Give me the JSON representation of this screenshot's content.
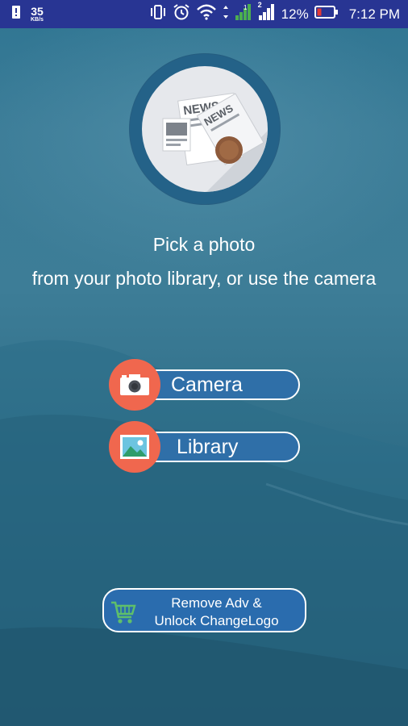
{
  "status_bar": {
    "net_speed_value": "35",
    "net_speed_unit": "KB/s",
    "battery_percent": "12%",
    "time": "7:12 PM",
    "sim_label": "2"
  },
  "prompt": {
    "line1": "Pick a photo",
    "line2": "from your photo library, or use the camera"
  },
  "buttons": {
    "camera_label": "Camera",
    "library_label": "Library"
  },
  "upgrade": {
    "line1": "Remove Adv &",
    "line2": "Unlock ChangeLogo"
  },
  "logo": {
    "news_text_1": "NEWS",
    "news_text_2": "NEWS"
  },
  "colors": {
    "status_bar": "#283593",
    "accent_orange": "#f0674e",
    "button_blue": "#2f6fa8",
    "signal_green": "#4caf50",
    "battery_red": "#e53935"
  }
}
